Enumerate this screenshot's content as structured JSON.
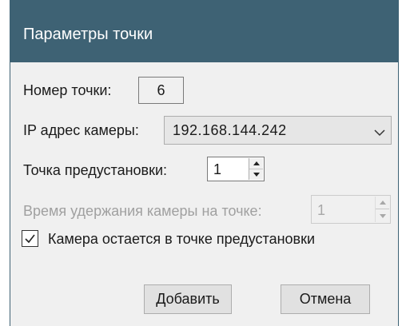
{
  "window": {
    "title": "Параметры точки"
  },
  "form": {
    "point_number_label": "Номер точки:",
    "point_number_value": "6",
    "camera_ip_label": "IP адрес камеры:",
    "camera_ip_value": "192.168.144.242",
    "preset_label": "Точка предустановки:",
    "preset_value": "1",
    "hold_time_label": "Время удержания камеры на точке:",
    "hold_time_value": "1",
    "stay_checkbox_label": "Камера остается в точке предустановки",
    "stay_checkbox_checked": true
  },
  "buttons": {
    "add_label": "Добавить",
    "cancel_label": "Отмена"
  },
  "colors": {
    "titlebar": "#3e6274",
    "dialog_bg": "#f0f0f0",
    "disabled_text": "#a0a0a0"
  },
  "icons": {
    "combo_arrow": "chevron-down-icon",
    "spin_up": "triangle-up-icon",
    "spin_down": "triangle-down-icon",
    "check": "checkmark-icon"
  }
}
